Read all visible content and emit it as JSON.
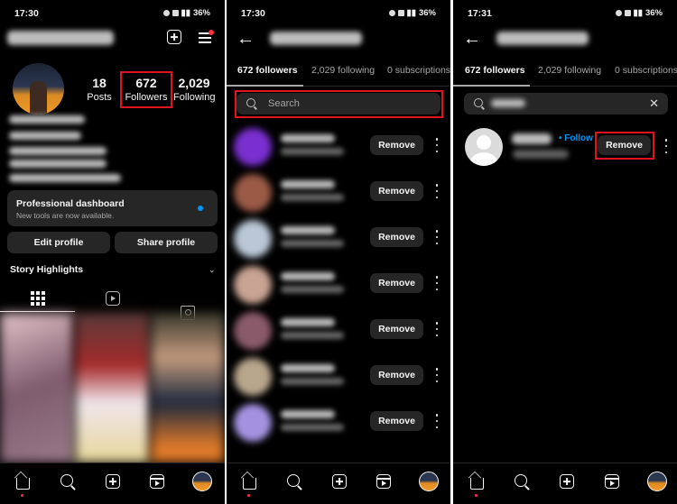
{
  "status_bar": [
    {
      "time": "17:30",
      "battery": "36%"
    },
    {
      "time": "17:30",
      "battery": "36%"
    },
    {
      "time": "17:31",
      "battery": "36%"
    }
  ],
  "profile": {
    "username": "(blurred)",
    "stats": [
      {
        "value": "18",
        "label": "Posts"
      },
      {
        "value": "672",
        "label": "Followers"
      },
      {
        "value": "2,029",
        "label": "Following"
      }
    ],
    "professional_dashboard": {
      "title": "Professional dashboard",
      "subtitle": "New tools are now available."
    },
    "buttons": {
      "edit": "Edit profile",
      "share": "Share profile"
    },
    "story_highlights": "Story Highlights",
    "content_tabs": [
      "grid",
      "reels",
      "tagged"
    ]
  },
  "followers_screen": {
    "tabs": [
      {
        "label": "672 followers",
        "active": true
      },
      {
        "label": "2,029 following",
        "active": false
      },
      {
        "label": "0 subscriptions",
        "active": false
      }
    ],
    "search_placeholder": "Search",
    "remove_label": "Remove",
    "rows": [
      {
        "avatar_color": "#7a2fd0"
      },
      {
        "avatar_color": "#9a5a46"
      },
      {
        "avatar_color": "#b9c7d6"
      },
      {
        "avatar_color": "#c9a393"
      },
      {
        "avatar_color": "#8a5a6a"
      },
      {
        "avatar_color": "#b8a68c"
      },
      {
        "avatar_color": "#a492e0"
      }
    ]
  },
  "search_result_screen": {
    "tabs": [
      {
        "label": "672 followers",
        "active": true
      },
      {
        "label": "2,029 following",
        "active": false
      },
      {
        "label": "0 subscriptions",
        "active": false
      }
    ],
    "search_value": "(blurred)",
    "result": {
      "follow_label": "• Follow",
      "remove_label": "Remove"
    }
  },
  "bottom_nav": [
    "home",
    "search",
    "create",
    "reels",
    "profile"
  ],
  "colors": {
    "highlight": "#e0141e",
    "link_blue": "#0095f6",
    "notification_red": "#ff3040"
  }
}
